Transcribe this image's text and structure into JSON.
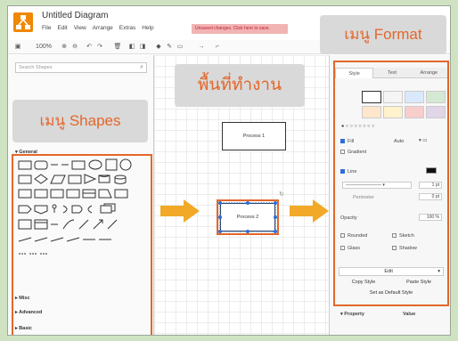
{
  "app": {
    "title": "Untitled Diagram",
    "menu": [
      "File",
      "Edit",
      "View",
      "Arrange",
      "Extras",
      "Help"
    ],
    "warning": "Unsaved changes. Click here to save."
  },
  "toolbar": {
    "zoom": "100%"
  },
  "left_panel": {
    "search_placeholder": "Search Shapes",
    "sections": [
      "General",
      "Misc",
      "Advanced",
      "Basic"
    ]
  },
  "canvas": {
    "nodes": [
      {
        "label": "Process 1"
      },
      {
        "label": "Process 2"
      }
    ]
  },
  "format_panel": {
    "tabs": [
      "Style",
      "Text",
      "Arrange"
    ],
    "fill_label": "Fill",
    "fill_mode": "Auto",
    "gradient_label": "Gradient",
    "line_label": "Line",
    "line_width": "1 pt",
    "perimeter_label": "Perimeter",
    "perimeter_value": "0 pt",
    "opacity_label": "Opacity",
    "opacity_value": "100 %",
    "options": [
      "Rounded",
      "Sketch",
      "Glass",
      "Shadow"
    ],
    "edit_label": "Edit",
    "copy_style": "Copy Style",
    "paste_style": "Paste Style",
    "default_style": "Set as Default Style",
    "property_col": "Property",
    "value_col": "Value",
    "swatch_colors": [
      "#ffffff",
      "#f5f5f5",
      "#dae8fc",
      "#d5e8d4",
      "#ffe6cc",
      "#fff2cc",
      "#f8cecc",
      "#e1d5e7"
    ]
  },
  "annotations": {
    "shapes_menu": "เมนู Shapes",
    "workspace": "พื้นที่ทำงาน",
    "format_menu": "เมนู Format"
  },
  "colors": {
    "accent_orange": "#e3672b",
    "arrow_yellow": "#f2a928",
    "selection_blue": "#2b6ed8",
    "background_green": "#cfe3c2"
  }
}
